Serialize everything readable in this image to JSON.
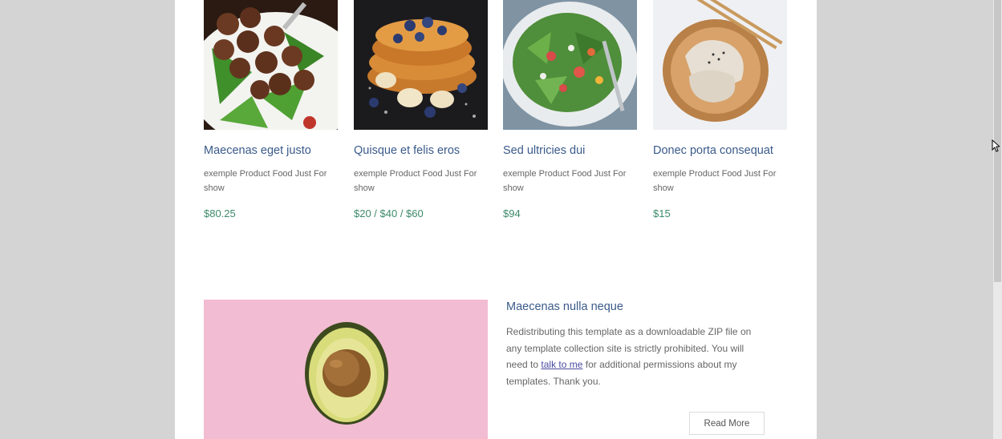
{
  "products": [
    {
      "title": "Maecenas eget justo",
      "desc": "exemple Product Food Just For show",
      "price": "$80.25",
      "image": "meatballs-salad-photo"
    },
    {
      "title": "Quisque et felis eros",
      "desc": "exemple Product Food Just For show",
      "price": "$20 / $40 / $60",
      "image": "french-toast-photo"
    },
    {
      "title": "Sed ultricies dui",
      "desc": "exemple Product Food Just For show",
      "price": "$94",
      "image": "salad-bowl-photo"
    },
    {
      "title": "Donec porta consequat",
      "desc": "exemple Product Food Just For show",
      "price": "$15",
      "image": "dumplings-photo"
    }
  ],
  "feature": {
    "title": "Maecenas nulla neque",
    "body_before": "Redistributing this template as a downloadable ZIP file on any template collection site is strictly prohibited. You will need to",
    "link_text": "talk to me",
    "body_after": "for additional permissions about my templates. Thank you.",
    "button": "Read More",
    "image": "avocado-photo"
  },
  "colors": {
    "page_bg": "#d4d4d4",
    "title": "#3a5a8a",
    "price": "#3d8a6a",
    "feature_bg": "#f2bcd2"
  }
}
